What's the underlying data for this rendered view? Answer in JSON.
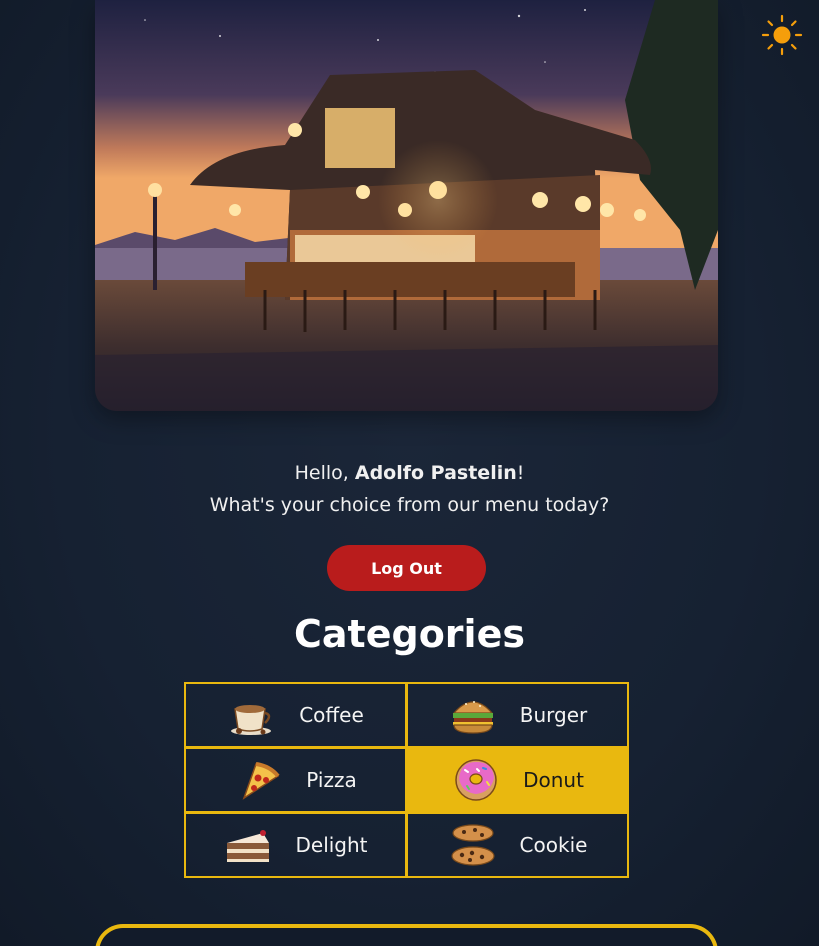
{
  "hero": {
    "alt": "Lakeside cafe at dusk"
  },
  "theme_toggle": {
    "icon": "sun-icon",
    "color": "#f59e0b"
  },
  "greeting": {
    "hello": "Hello, ",
    "name": "Adolfo Pastelin",
    "exclaim": "!",
    "question": "What's your choice from our menu today?"
  },
  "logout": {
    "label": "Log Out",
    "color": "#b91c1c"
  },
  "categories": {
    "title": "Categories",
    "accent": "#e9b80f",
    "items": [
      {
        "label": "Coffee",
        "icon": "coffee-cup-icon"
      },
      {
        "label": "Burger",
        "icon": "burger-icon"
      },
      {
        "label": "Pizza",
        "icon": "pizza-slice-icon"
      },
      {
        "label": "Donut",
        "icon": "donut-icon",
        "selected": true
      },
      {
        "label": "Delight",
        "icon": "cake-slice-icon"
      },
      {
        "label": "Cookie",
        "icon": "cookies-icon"
      }
    ]
  }
}
